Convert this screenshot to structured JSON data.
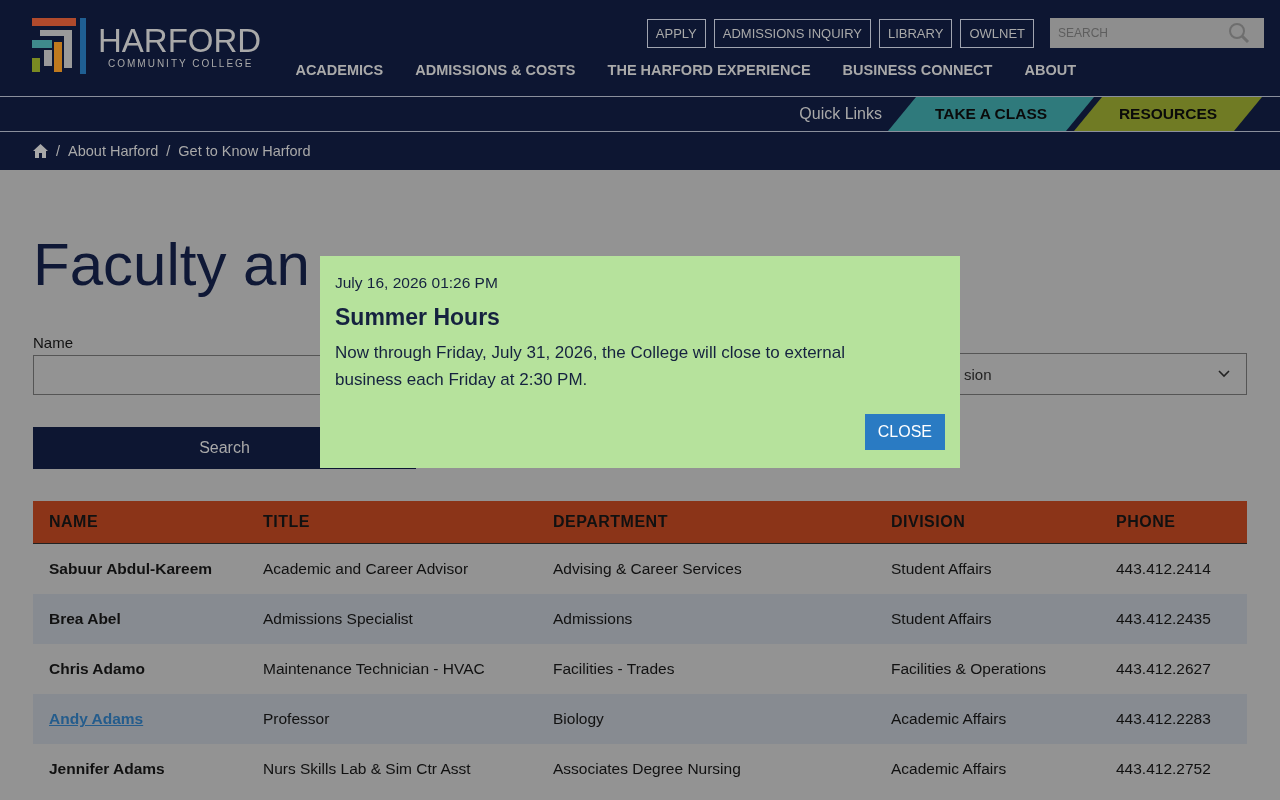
{
  "header": {
    "logo": {
      "name": "HARFORD",
      "subtitle": "COMMUNITY COLLEGE"
    },
    "utility_links": [
      "APPLY",
      "ADMISSIONS INQUIRY",
      "LIBRARY",
      "OWLNET"
    ],
    "search": {
      "placeholder": "SEARCH"
    },
    "nav": [
      "ACADEMICS",
      "ADMISSIONS & COSTS",
      "THE HARFORD EXPERIENCE",
      "BUSINESS CONNECT",
      "ABOUT"
    ]
  },
  "quick_links": {
    "label": "Quick Links",
    "items": [
      {
        "label": "TAKE A CLASS",
        "color": "#2f7a7c"
      },
      {
        "label": "RESOURCES",
        "color": "#707b24"
      }
    ]
  },
  "breadcrumb": {
    "separator": "/",
    "items": [
      "About Harford",
      "Get to Know Harford"
    ]
  },
  "page": {
    "title": "Faculty an",
    "name_label": "Name",
    "select_value": "sion",
    "search_button": "Search"
  },
  "modal": {
    "date": "July 16, 2026 01:26 PM",
    "title": "Summer Hours",
    "body": "Now through Friday, July 31, 2026, the College will close to external business each Friday at 2:30 PM.",
    "close": "CLOSE"
  },
  "table": {
    "columns": [
      "NAME",
      "TITLE",
      "DEPARTMENT",
      "DIVISION",
      "PHONE"
    ],
    "rows": [
      {
        "link": false,
        "cells": [
          "Sabuur Abdul-Kareem",
          "Academic and Career Advisor",
          "Advising & Career Services",
          "Student Affairs",
          "443.412.2414"
        ]
      },
      {
        "link": false,
        "cells": [
          "Brea Abel",
          "Admissions Specialist",
          "Admissions",
          "Student Affairs",
          "443.412.2435"
        ]
      },
      {
        "link": false,
        "cells": [
          "Chris Adamo",
          "Maintenance Technician - HVAC",
          "Facilities - Trades",
          "Facilities & Operations",
          "443.412.2627"
        ]
      },
      {
        "link": true,
        "cells": [
          "Andy Adams",
          "Professor",
          "Biology",
          "Academic Affairs",
          "443.412.2283"
        ]
      },
      {
        "link": false,
        "cells": [
          "Jennifer Adams",
          "Nurs Skills Lab & Sim Ctr Asst",
          "Associates Degree Nursing",
          "Academic Affairs",
          "443.412.2752"
        ]
      }
    ]
  }
}
